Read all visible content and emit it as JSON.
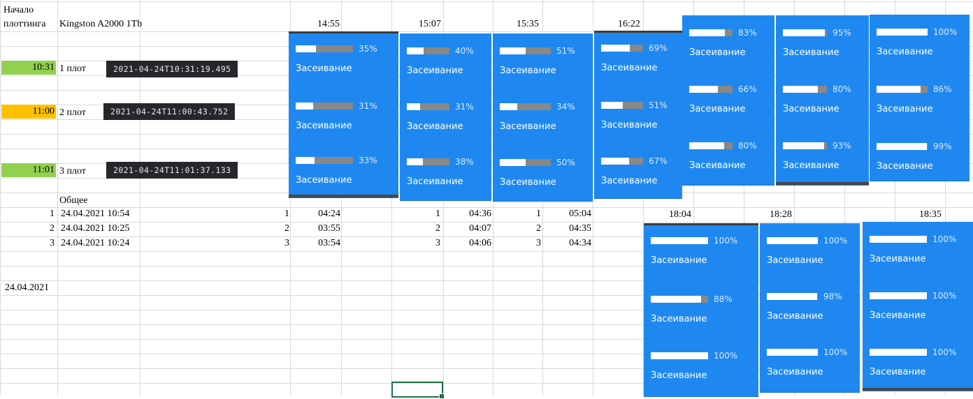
{
  "sheet": {
    "header_label_line1": "Начало",
    "header_label_line2": "плоттинга",
    "drive": "Kingston A2000 1Tb",
    "times_top": [
      "14:55",
      "15:07",
      "15:35",
      "16:22"
    ],
    "times_bottom": [
      "18:04",
      "18:28",
      "18:35"
    ],
    "plots": [
      {
        "start": "10:31",
        "name": "1 плот",
        "timestamp": "2021-04-24T10:31:19.495",
        "color": "#92d050"
      },
      {
        "start": "11:00",
        "name": "2 плот",
        "timestamp": "2021-04-24T11:00:43.752",
        "color": "#ffc000"
      },
      {
        "start": "11:01",
        "name": "3 плот",
        "timestamp": "2021-04-24T11:01:37.133",
        "color": "#92d050"
      }
    ],
    "total_label": "Общее",
    "totals": [
      {
        "n": "1",
        "datetime": "24.04.2021 10:54"
      },
      {
        "n": "2",
        "datetime": "24.04.2021 10:25"
      },
      {
        "n": "3",
        "datetime": "24.04.2021 10:24"
      }
    ],
    "durations": [
      {
        "rows": [
          {
            "n": "1",
            "t": "04:24"
          },
          {
            "n": "2",
            "t": "03:55"
          },
          {
            "n": "3",
            "t": "03:54"
          }
        ]
      },
      {
        "rows": [
          {
            "n": "1",
            "t": "04:36"
          },
          {
            "n": "2",
            "t": "04:07"
          },
          {
            "n": "3",
            "t": "04:06"
          }
        ]
      },
      {
        "rows": [
          {
            "n": "1",
            "t": "05:04"
          },
          {
            "n": "2",
            "t": "04:35"
          },
          {
            "n": "3",
            "t": "04:34"
          }
        ]
      }
    ],
    "date": "24.04.2021"
  },
  "status_label": "Засеивание",
  "snapshots": [
    {
      "progress": [
        35,
        31,
        33
      ],
      "pct_text": [
        "35%",
        "31%",
        "33%"
      ]
    },
    {
      "progress": [
        40,
        31,
        38
      ],
      "pct_text": [
        "40%",
        "31%",
        "38%"
      ]
    },
    {
      "progress": [
        51,
        34,
        50
      ],
      "pct_text": [
        "51%",
        "34%",
        "50%"
      ]
    },
    {
      "progress": [
        69,
        51,
        67
      ],
      "pct_text": [
        "69%",
        "51%",
        "67%"
      ]
    },
    {
      "progress": [
        83,
        66,
        80
      ],
      "pct_text": [
        "83%",
        "66%",
        "80%"
      ]
    },
    {
      "progress": [
        95,
        80,
        93
      ],
      "pct_text": [
        "95%",
        "80%",
        "93%"
      ]
    },
    {
      "progress": [
        100,
        86,
        99
      ],
      "pct_text": [
        "100%",
        "86%",
        "99%"
      ]
    },
    {
      "progress": [
        100,
        88,
        100
      ],
      "pct_text": [
        "100%",
        "88%",
        "100%"
      ]
    },
    {
      "progress": [
        100,
        98,
        100
      ],
      "pct_text": [
        "100%",
        "98%",
        "100%"
      ]
    },
    {
      "progress": [
        100,
        100,
        100
      ],
      "pct_text": [
        "100%",
        "100%",
        "100%"
      ]
    }
  ],
  "colors": {
    "panel": "#1e88f0",
    "bar_track": "#888888",
    "bar_fill": "#ffffff",
    "stamp_bg": "#25272b"
  }
}
